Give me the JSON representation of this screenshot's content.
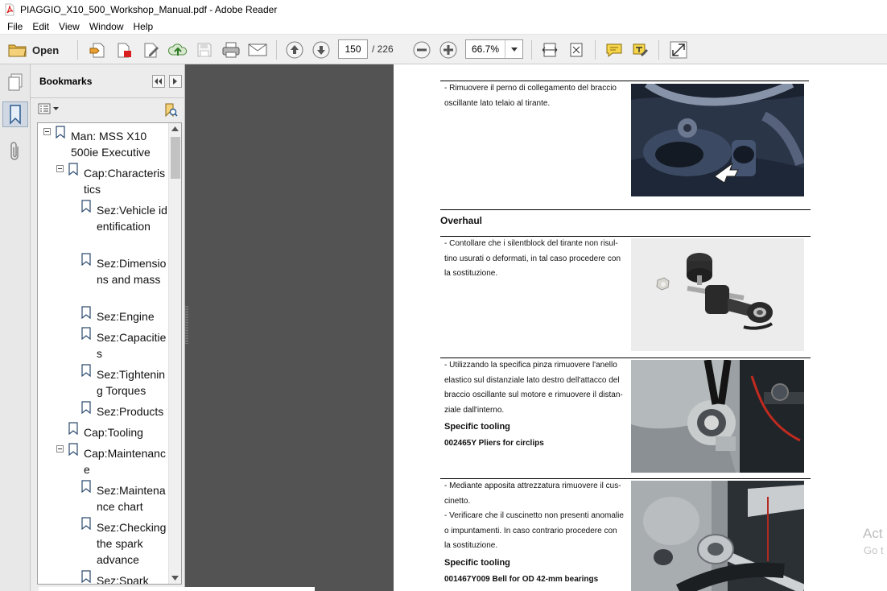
{
  "window": {
    "title": "PIAGGIO_X10_500_Workshop_Manual.pdf - Adobe Reader"
  },
  "menu": {
    "items": [
      "File",
      "Edit",
      "View",
      "Window",
      "Help"
    ]
  },
  "toolbar": {
    "open_label": "Open",
    "page_current": "150",
    "page_total": "/  226",
    "zoom": "66.7%",
    "icons": [
      "folder-icon",
      "create-pdf-icon",
      "export-pdf-icon",
      "edit-icon",
      "upload-icon",
      "save-icon",
      "print-icon",
      "email-icon",
      "previous-page-icon",
      "next-page-icon",
      "zoom-out-icon",
      "zoom-in-icon",
      "fit-width-icon",
      "fit-page-icon",
      "comment-icon",
      "highlight-icon",
      "fullscreen-icon"
    ]
  },
  "sidebar": {
    "title": "Bookmarks",
    "items": [
      {
        "label": "Man: MSS X10 500ie Executive"
      },
      {
        "label": "Cap:Characteristics"
      },
      {
        "label": "Sez:Vehicle identification"
      },
      {
        "label": "Sez:Dimensions and mass"
      },
      {
        "label": "Sez:Engine"
      },
      {
        "label": "Sez:Capacities"
      },
      {
        "label": "Sez:Tightening Torques"
      },
      {
        "label": "Sez:Products"
      },
      {
        "label": "Cap:Tooling"
      },
      {
        "label": "Cap:Maintenance"
      },
      {
        "label": "Sez:Maintenance chart"
      },
      {
        "label": "Sez:Checking the spark advance"
      },
      {
        "label": "Sez:Spark"
      }
    ]
  },
  "document": {
    "step1": [
      "- Rimuovere il perno di collegamento del braccio",
      "oscillante lato telaio al tirante."
    ],
    "section_title": "Overhaul",
    "step2": [
      "- Contollare che i silentblock del tirante non risul-",
      "tino usurati o deformati, in tal caso procedere con",
      "la sostituzione."
    ],
    "step3": [
      "- Utilizzando la specifica pinza rimuovere l'anello",
      "elastico sul distanziale lato destro dell'attacco del",
      "braccio oscillante sul motore e rimuovere il distan-",
      "ziale dall'interno."
    ],
    "step3_tooling_title": "Specific tooling",
    "step3_tool": "002465Y Pliers for circlips",
    "step4": [
      "- Mediante apposita attrezzatura rimuovere il cus-",
      "cinetto.",
      "- Verificare che il cuscinetto non presenti anomalie",
      "o impuntamenti. In caso contrario procedere con",
      "la sostituzione."
    ],
    "step4_tooling_title": "Specific tooling",
    "step4_tool": "001467Y009 Bell for OD 42-mm bearings"
  },
  "watermark": {
    "line1": "Act",
    "line2": "Go t"
  },
  "colors": {
    "viewer_background": "#535353",
    "toolbar_background": "#f0f0f0",
    "pdf_red": "#d9201e"
  }
}
